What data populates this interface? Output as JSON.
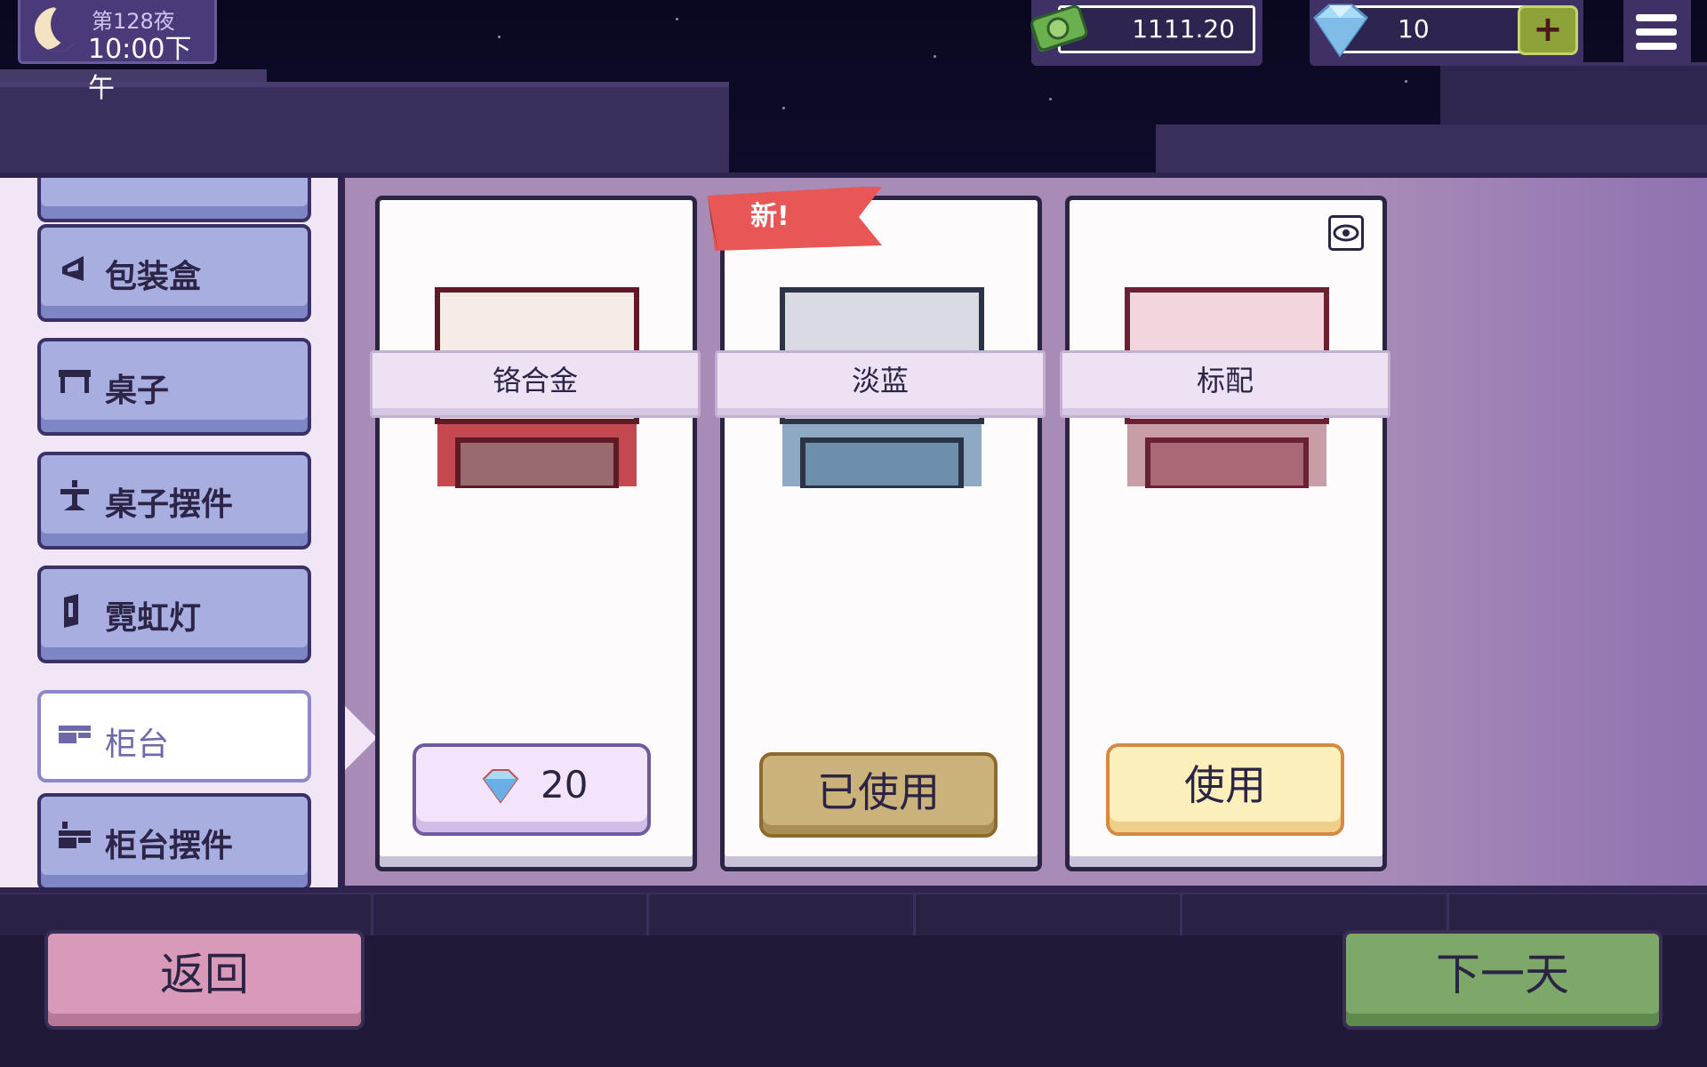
{
  "hud": {
    "night_label": "第128夜",
    "clock": "10:00下午",
    "money": "1111.20",
    "gems": "10",
    "add_gems_label": "+"
  },
  "categories": [
    {
      "label": "",
      "icon": "partial-item-icon",
      "active": false
    },
    {
      "label": "包装盒",
      "icon": "box-icon",
      "active": false
    },
    {
      "label": "桌子",
      "icon": "table-icon",
      "active": false
    },
    {
      "label": "桌子摆件",
      "icon": "table-decor-icon",
      "active": false
    },
    {
      "label": "霓虹灯",
      "icon": "neon-light-icon",
      "active": false
    },
    {
      "label": "柜台",
      "icon": "counter-icon",
      "active": true
    },
    {
      "label": "柜台摆件",
      "icon": "counter-decor-icon",
      "active": false
    }
  ],
  "items": [
    {
      "name": "铬合金",
      "colors": {
        "top": "#f4ede6",
        "bottom": "#c5474f",
        "inner": "#9a6b6e",
        "outline": "#5e1a26"
      },
      "action": "price",
      "price": "20"
    },
    {
      "name": "淡蓝",
      "colors": {
        "top": "#dadbe2",
        "bottom": "#8ea9c4",
        "inner": "#6d8fab",
        "outline": "#2b3344"
      },
      "action": "used",
      "action_label": "已使用",
      "badge": "新!"
    },
    {
      "name": "标配",
      "colors": {
        "top": "#f1d6dd",
        "bottom": "#c99da6",
        "inner": "#a96873",
        "outline": "#6a2233"
      },
      "action": "use",
      "action_label": "使用",
      "icon": "eye-icon"
    }
  ],
  "footer": {
    "back_label": "返回",
    "next_label": "下一天"
  },
  "colors": {
    "sidebar_item": "#a9aee0",
    "panel": "#a98bb8",
    "back": "#d89ab8",
    "next": "#7ea86a"
  }
}
